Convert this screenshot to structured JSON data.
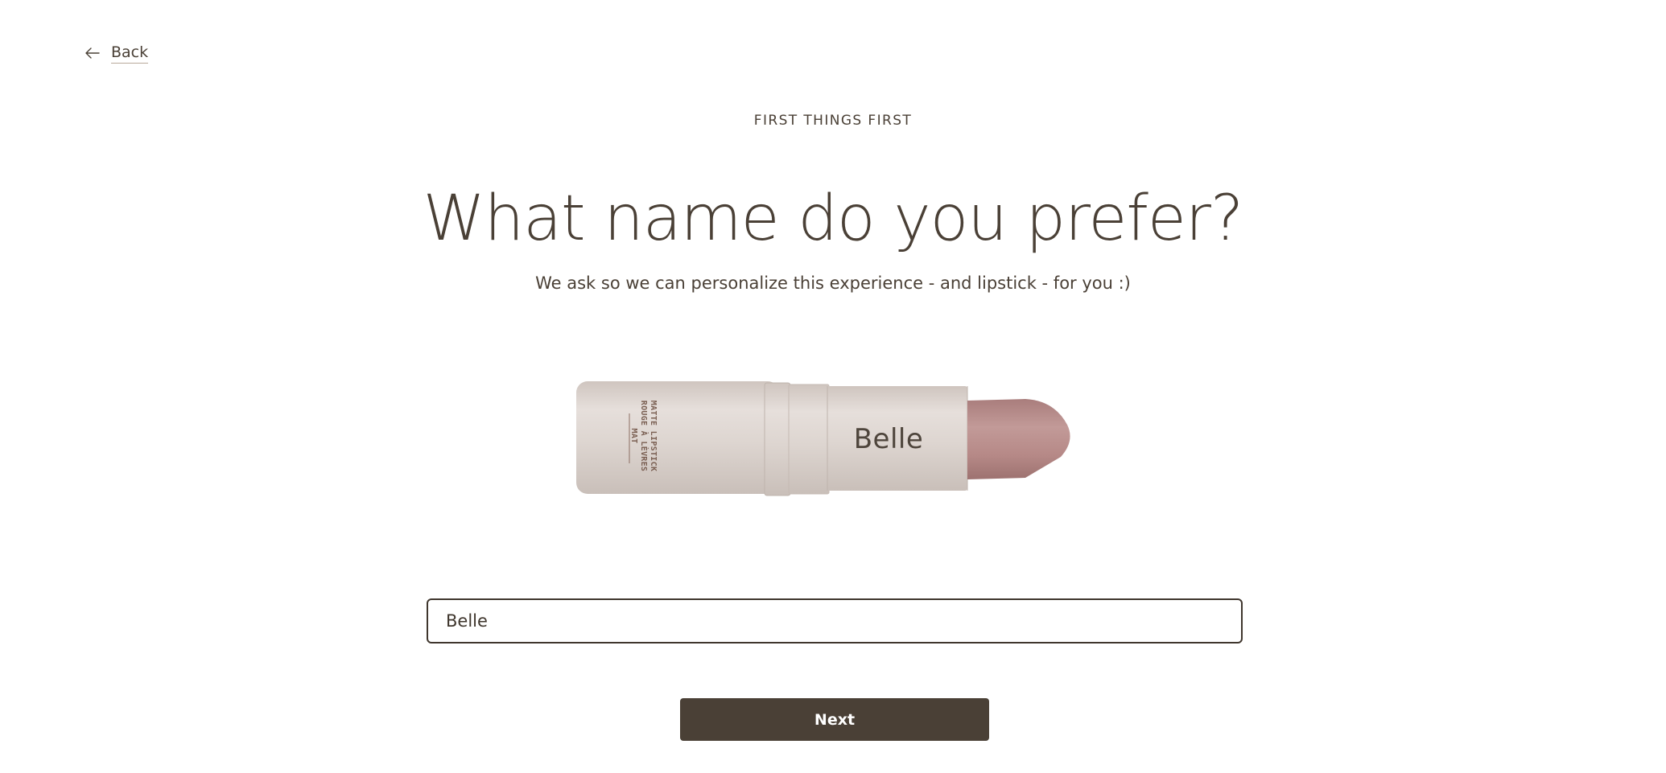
{
  "nav": {
    "back_label": "Back",
    "back_icon": "arrow-left-icon"
  },
  "step": {
    "eyebrow": "FIRST THINGS FIRST",
    "title": "What name do you prefer?",
    "subtitle": "We ask so we can personalize this experience - and lipstick - for you :)"
  },
  "product": {
    "engraved_name": "Belle",
    "case_line_1": "MATTE LIPSTICK",
    "case_line_2": "ROUGE À LÈVRES MAT"
  },
  "form": {
    "name_value": "Belle",
    "next_label": "Next"
  },
  "colors": {
    "text": "#4a4036",
    "button_bg": "#4a4036",
    "button_text": "#ffffff",
    "input_border": "#3f362d",
    "tube": "#d9d2cd",
    "bullet": "#b98b8a"
  }
}
